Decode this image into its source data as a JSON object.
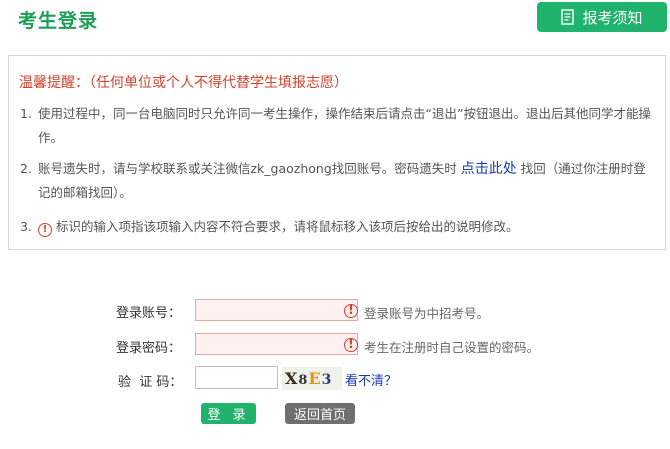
{
  "header": {
    "title": "考生登录",
    "notice_button": "报考须知",
    "notice_icon": "document-icon"
  },
  "notice": {
    "warning": "温馨提醒：（任何单位或个人不得代替学生填报志愿）",
    "items": [
      {
        "num": "1.",
        "text": "使用过程中，同一台电脑同时只允许同一考生操作，操作结束后请点击“退出”按钮退出。退出后其他同学才能操作。"
      },
      {
        "num": "2.",
        "text_before": "账号遗失时，请与学校联系或关注微信zk_gaozhong找回账号。密码遗失时",
        "link": "点击此处",
        "text_after": "找回（通过你注册时登记的邮箱找回）。"
      },
      {
        "num": "3.",
        "icon": "!",
        "text": "标识的输入项指该项输入内容不符合要求，请将鼠标移入该项后按给出的说明修改。"
      }
    ]
  },
  "form": {
    "account_label": "登录账号：",
    "account_value": "",
    "account_hint": "登录账号为中招考号。",
    "password_label": "登录密码：",
    "password_value": "",
    "password_hint": "考生在注册时自己设置的密码。",
    "captcha_label": "验  证 码：",
    "captcha_value": "",
    "captcha_chars": [
      "X",
      "8",
      "E",
      "3"
    ],
    "captcha_refresh": "看不清？",
    "error_mark": "!",
    "login_button": "登 录",
    "home_button": "返回首页"
  },
  "colors": {
    "brand_green": "#1fb36c",
    "title_green": "#1d9e57",
    "warning_red": "#d2432d",
    "link_blue": "#1a3cad",
    "gray_button": "#6f6f6f"
  }
}
